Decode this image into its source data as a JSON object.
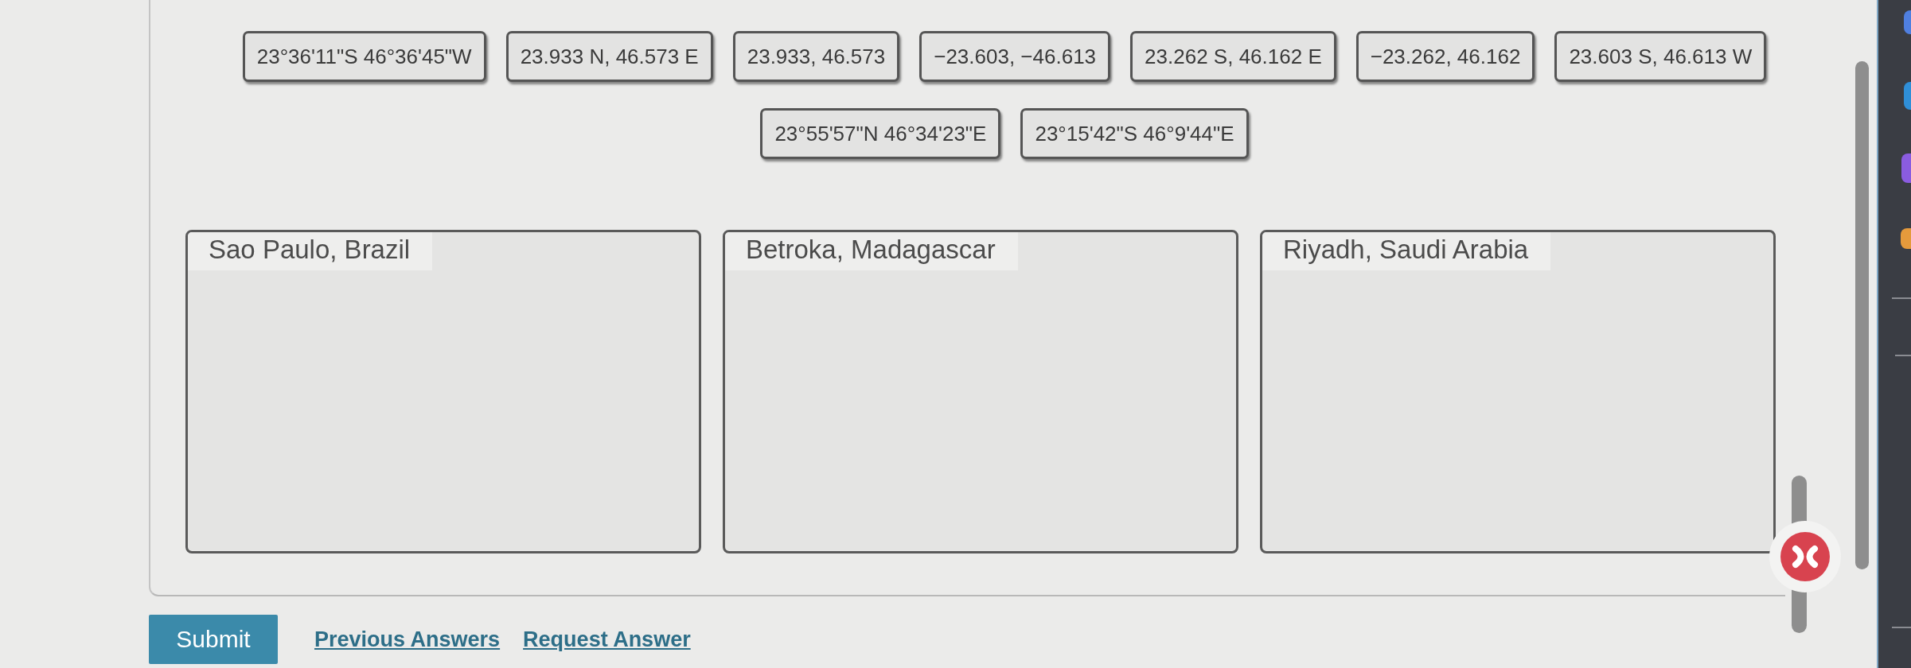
{
  "answer_chips": [
    "23°36'11\"S 46°36'45\"W",
    "23.933 N, 46.573 E",
    "23.933, 46.573",
    "−23.603, −46.613",
    "23.262 S, 46.162 E",
    "−23.262, 46.162",
    "23.603 S, 46.613 W",
    "23°55'57\"N 46°34'23\"E",
    "23°15'42\"S 46°9'44\"E"
  ],
  "drop_zones": [
    {
      "label": "Sao Paulo, Brazil"
    },
    {
      "label": "Betroka, Madagascar"
    },
    {
      "label": "Riyadh, Saudi Arabia"
    }
  ],
  "actions": {
    "submit": "Submit",
    "links": [
      "Previous Answers",
      "Request Answer"
    ]
  }
}
